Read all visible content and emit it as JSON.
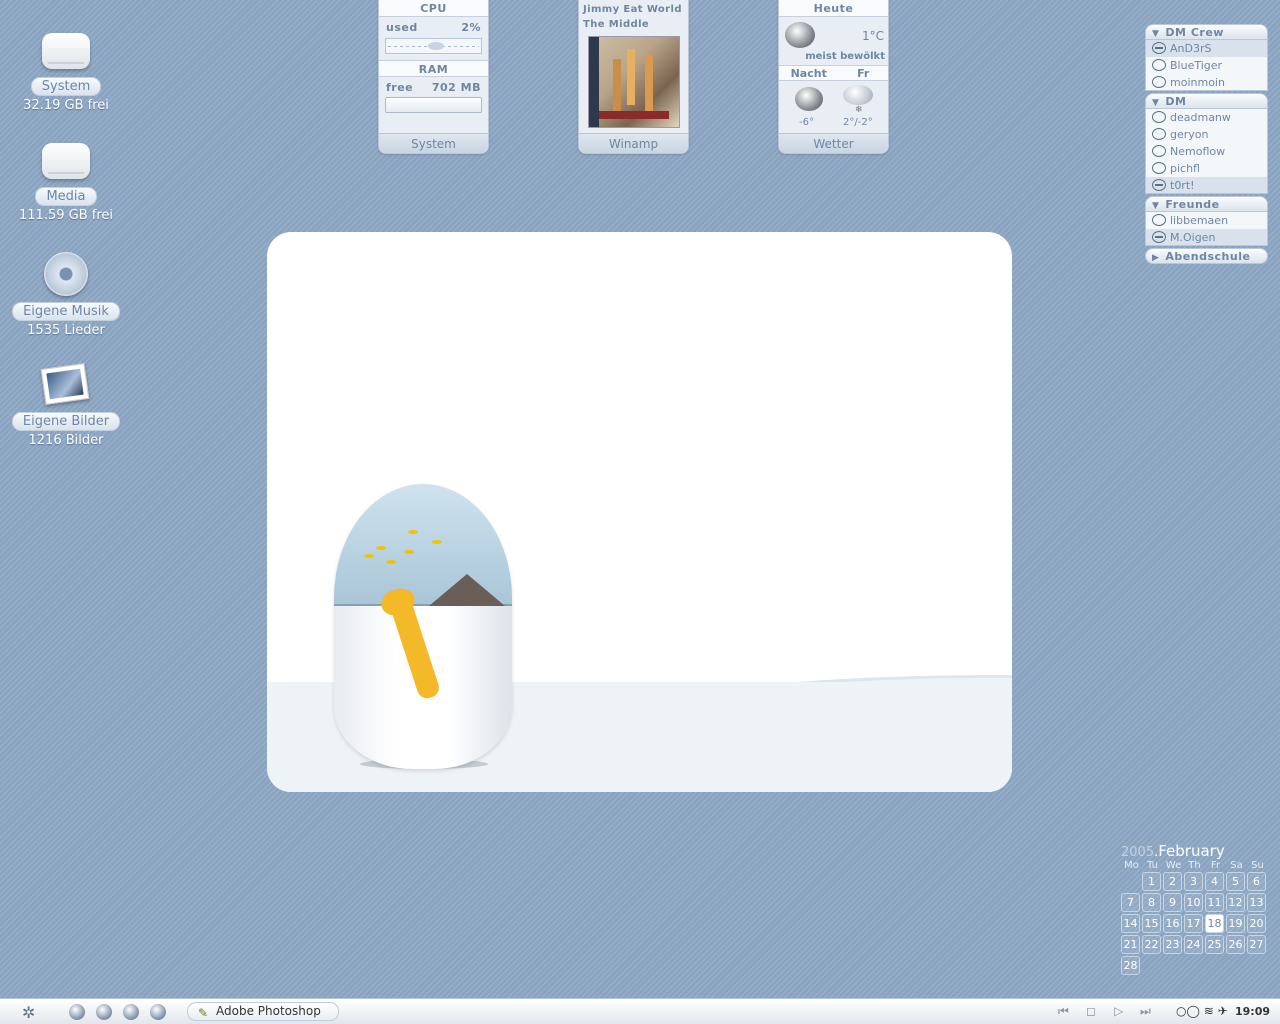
{
  "desktop_icons": [
    {
      "label": "System",
      "sub": "32.19 GB frei",
      "icon": "hard-drive-icon"
    },
    {
      "label": "Media",
      "sub": "111.59 GB frei",
      "icon": "hard-drive-icon"
    },
    {
      "label": "Eigene Musik",
      "sub": "1535 Lieder",
      "icon": "music-disc-icon"
    },
    {
      "label": "Eigene Bilder",
      "sub": "1216 Bilder",
      "icon": "photos-icon"
    }
  ],
  "system_widget": {
    "cpu_title": "CPU",
    "cpu_used_label": "used",
    "cpu_used_value": "2%",
    "ram_title": "RAM",
    "ram_free_label": "free",
    "ram_free_value": "702 MB",
    "footer": "System"
  },
  "winamp_widget": {
    "artist": "Jimmy Eat World",
    "album": "The Middle",
    "footer": "Winamp"
  },
  "weather_widget": {
    "today_label": "Heute",
    "today_temp": "1°C",
    "today_desc": "meist bewölkt",
    "night_label": "Nacht",
    "night_temp": "-6°",
    "fri_label": "Fr",
    "fri_temp": "2°/-2°",
    "footer": "Wetter"
  },
  "buddy_list": {
    "groups": [
      {
        "name": "DM Crew",
        "collapsed": false,
        "members": [
          "AnD3rS",
          "BlueTiger",
          "moinmoin"
        ]
      },
      {
        "name": "DM",
        "collapsed": false,
        "members": [
          "deadmanw",
          "geryon",
          "Nemoflow",
          "pichfl",
          "t0rt!"
        ]
      },
      {
        "name": "Freunde",
        "collapsed": false,
        "members": [
          "libbemaen",
          "M.Oigen"
        ]
      },
      {
        "name": "Abendschule",
        "collapsed": true,
        "members": []
      }
    ]
  },
  "calendar": {
    "year": "2005",
    "month": "February",
    "weekdays": [
      "Mo",
      "Tu",
      "We",
      "Th",
      "Fr",
      "Sa",
      "Su"
    ],
    "days": [
      "1",
      "2",
      "3",
      "4",
      "5",
      "6",
      "7",
      "8",
      "9",
      "10",
      "11",
      "12",
      "13",
      "14",
      "15",
      "16",
      "17",
      "18",
      "19",
      "20",
      "21",
      "22",
      "23",
      "24",
      "25",
      "26",
      "27",
      "28"
    ],
    "today": "18"
  },
  "taskbar": {
    "task_label": "Adobe Photoshop",
    "clock": "19:09"
  }
}
